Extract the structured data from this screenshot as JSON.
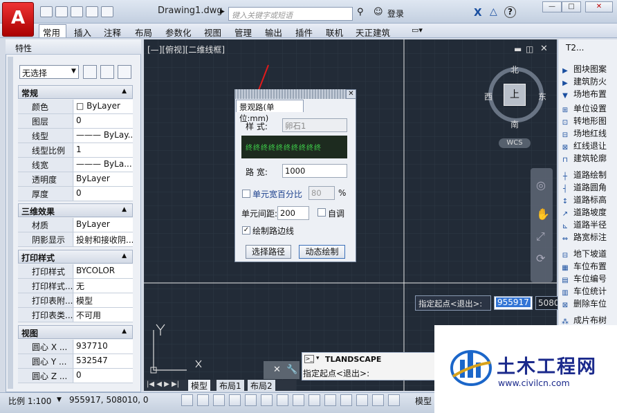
{
  "title_bar": {
    "app_button_label": "A",
    "document_title": "Drawing1.dwg",
    "search_placeholder": "键入关键字或短语",
    "login_label": "登录",
    "help_label": "?",
    "minimize": "—",
    "restore": "□",
    "close": "✕"
  },
  "menu": {
    "tabs": [
      "常用",
      "插入",
      "注释",
      "布局",
      "参数化",
      "视图",
      "管理",
      "输出",
      "插件",
      "联机",
      "天正建筑"
    ]
  },
  "properties_panel": {
    "title": "特性",
    "selection": "无选择",
    "sections": {
      "general": {
        "title": "常规",
        "rows": [
          {
            "key": "颜色",
            "value": "□ ByLayer"
          },
          {
            "key": "图层",
            "value": "0"
          },
          {
            "key": "线型",
            "value": "——— ByLay..."
          },
          {
            "key": "线型比例",
            "value": "1"
          },
          {
            "key": "线宽",
            "value": "——— ByLa..."
          },
          {
            "key": "透明度",
            "value": "ByLayer"
          },
          {
            "key": "厚度",
            "value": "0"
          }
        ]
      },
      "3d": {
        "title": "三维效果",
        "rows": [
          {
            "key": "材质",
            "value": "ByLayer"
          },
          {
            "key": "阴影显示",
            "value": "投射和接收阴..."
          }
        ]
      },
      "plot": {
        "title": "打印样式",
        "rows": [
          {
            "key": "打印样式",
            "value": "BYCOLOR"
          },
          {
            "key": "打印样式...",
            "value": "无"
          },
          {
            "key": "打印表附...",
            "value": "模型"
          },
          {
            "key": "打印表类...",
            "value": "不可用"
          }
        ]
      },
      "view": {
        "title": "视图",
        "rows": [
          {
            "key": "圆心 X ...",
            "value": "937710"
          },
          {
            "key": "圆心 Y ...",
            "value": "532547"
          },
          {
            "key": "圆心 Z ...",
            "value": "0"
          }
        ]
      }
    }
  },
  "viewport": {
    "label": "[—][俯视][二维线框]",
    "compass": {
      "north": "北",
      "south": "南",
      "east": "东",
      "west": "西",
      "top": "上",
      "wcs": "WCS"
    },
    "ucs_x": "X",
    "ucs_y": "Y"
  },
  "dialog": {
    "tab": "景观路(单位:mm)",
    "style_label": "样  式:",
    "style_value": "卵石1",
    "pattern": "终终终终终终终终终终",
    "width_label": "路  宽:",
    "width_value": "1000",
    "unit_percent_label": "单元宽百分比",
    "unit_percent_value": "80",
    "percent_sign": "%",
    "unit_spacing_label": "单元间距:",
    "unit_spacing_value": "200",
    "auto_label": "自调",
    "draw_edge_label": "绘制路边线",
    "draw_edge_checked": "✓",
    "select_path_button": "选择路径",
    "dynamic_draw_button": "动态绘制"
  },
  "command": {
    "name": "TLANDSCAPE",
    "prompt": "指定起点<退出>:",
    "tooltip": "指定起点<退出>:",
    "coord_x": "955917",
    "coord_y": "508010"
  },
  "tool_palette": {
    "title": "T2...",
    "items": [
      "图块图案",
      "建筑防火",
      "场地布置",
      "单位设置",
      "转地形图",
      "场地红线",
      "红线退让",
      "建筑轮廓",
      "道路绘制",
      "道路圆角",
      "道路标高",
      "道路坡度",
      "道路半径",
      "路宽标注",
      "地下坡道",
      "车位布置",
      "车位编号",
      "车位统计",
      "删除车位",
      "成片布树"
    ]
  },
  "layout_tabs": [
    "模型",
    "布局1",
    "布局2"
  ],
  "status_bar": {
    "scale": "比例 1:100",
    "coords": "955917,   508010,  0",
    "model": "模型"
  },
  "watermark": {
    "title": "土木工程网",
    "url": "www.civilcn.com"
  },
  "colors": {
    "canvas": "#222b37",
    "accent_red": "#cc1111",
    "watermark_blue": "#1b2a8c",
    "pattern_green": "#3fd04b"
  }
}
